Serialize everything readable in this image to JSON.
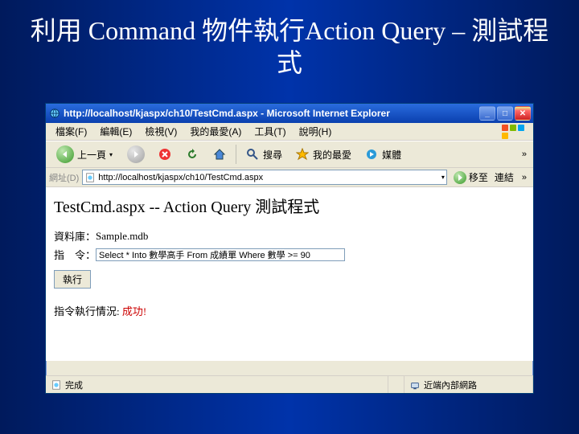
{
  "slide": {
    "title": "利用 Command 物件執行Action Query – 測試程式"
  },
  "window": {
    "title": "http://localhost/kjaspx/ch10/TestCmd.aspx - Microsoft Internet Explorer"
  },
  "menu": {
    "file": "檔案(F)",
    "edit": "編輯(E)",
    "view": "檢視(V)",
    "fav": "我的最愛(A)",
    "tools": "工具(T)",
    "help": "說明(H)"
  },
  "toolbar": {
    "back": "上一頁",
    "search": "搜尋",
    "fav": "我的最愛",
    "media": "媒體"
  },
  "address": {
    "label": "網址(D)",
    "url": "http://localhost/kjaspx/ch10/TestCmd.aspx",
    "go": "移至",
    "links": "連結"
  },
  "page": {
    "heading": "TestCmd.aspx -- Action Query 測試程式",
    "db_label": "資料庫：",
    "db_value": "Sample.mdb",
    "cmd_label": "指　令：",
    "cmd_value": "Select * Into 數學高手 From 成績單 Where 數學 >= 90",
    "run": "執行",
    "status_label": "指令執行情況: ",
    "status_value": "成功!"
  },
  "statusbar": {
    "done": "完成",
    "zone": "近端內部網路"
  }
}
